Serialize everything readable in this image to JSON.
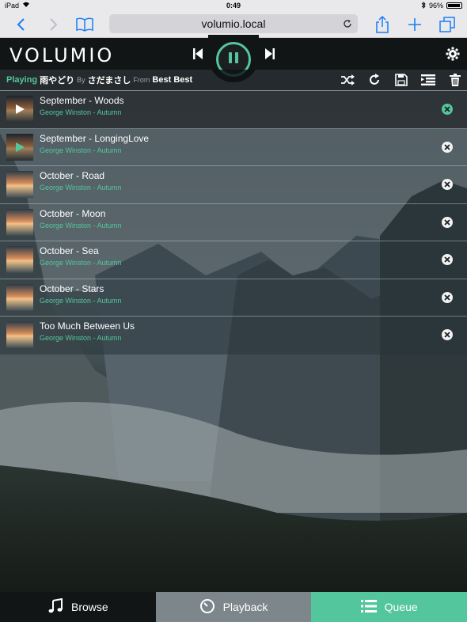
{
  "status_bar": {
    "device": "iPad",
    "time": "0:49",
    "battery": "96%",
    "battery_level": 0.96
  },
  "safari": {
    "url": "volumio.local",
    "icons": [
      "back-icon",
      "forward-icon",
      "bookmarks-icon",
      "reload-icon",
      "share-icon",
      "new-tab-icon",
      "tabs-icon"
    ]
  },
  "app": {
    "logo": "VOLUMIO",
    "icons": [
      "previous-icon",
      "pause-icon",
      "next-icon",
      "settings-icon"
    ]
  },
  "now_playing": {
    "label": "Playing",
    "title": "雨やどり",
    "by_label": "By",
    "artist": "さだまさし",
    "from_label": "From",
    "album": "Best Best",
    "actions": [
      "shuffle-icon",
      "repeat-icon",
      "save-icon",
      "add-to-playlist-icon",
      "clear-queue-icon"
    ]
  },
  "queue": [
    {
      "title": "September - Woods",
      "subtitle": "George Winston - Autumn",
      "state": "current"
    },
    {
      "title": "September - LongingLove",
      "subtitle": "George Winston - Autumn",
      "state": "hover"
    },
    {
      "title": "October - Road",
      "subtitle": "George Winston - Autumn",
      "state": ""
    },
    {
      "title": "October - Moon",
      "subtitle": "George Winston - Autumn",
      "state": ""
    },
    {
      "title": "October - Sea",
      "subtitle": "George Winston - Autumn",
      "state": ""
    },
    {
      "title": "October - Stars",
      "subtitle": "George Winston - Autumn",
      "state": ""
    },
    {
      "title": "Too Much Between Us",
      "subtitle": "George Winston - Autumn",
      "state": ""
    }
  ],
  "tabs": [
    {
      "label": "Browse",
      "icon": "music-note-icon",
      "active": false
    },
    {
      "label": "Playback",
      "icon": "clock-icon",
      "active": false
    },
    {
      "label": "Queue",
      "icon": "list-icon",
      "active": true
    }
  ],
  "colors": {
    "accent": "#54c69d",
    "header": "#121516",
    "playback_tab": "#7d868a"
  }
}
